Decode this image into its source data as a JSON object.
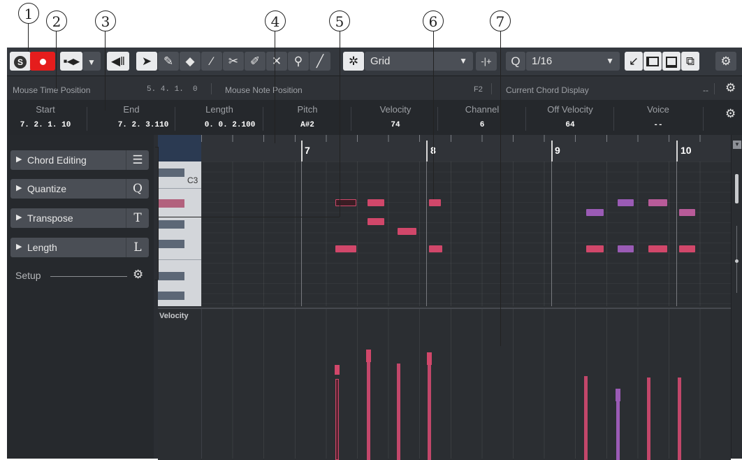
{
  "callouts": [
    "1",
    "2",
    "3",
    "4",
    "5",
    "6",
    "7"
  ],
  "toolbar": {
    "snap_label": "Grid",
    "quantize_label": "1/16",
    "icons": [
      "solo-icon",
      "record-icon",
      "transport-icon",
      "chevron-down-icon",
      "speaker-icon",
      "pointer-icon",
      "pencil-icon",
      "eraser-icon",
      "line-icon",
      "scissors-icon",
      "glue-icon",
      "mute-icon",
      "zoom-icon",
      "draw-icon",
      "snap-icon",
      "chevron-down-icon",
      "snap-toggle-icon",
      "quantize-icon",
      "chevron-down-icon",
      "arrow-icon",
      "left-zone-icon",
      "lower-zone-icon",
      "setup-icon",
      "gear-icon"
    ]
  },
  "infobar": {
    "mouse_time_label": "Mouse Time Position",
    "mouse_time_value": "5. 4. 1.  0",
    "mouse_note_label": "Mouse Note Position",
    "mouse_note_value": "F2",
    "chord_label": "Current Chord Display",
    "chord_value": "--"
  },
  "event": {
    "columns": [
      {
        "label": "Start",
        "value": "7. 2. 1. 10"
      },
      {
        "label": "End",
        "value": "7. 2. 3.110"
      },
      {
        "label": "Length",
        "value": "0. 0. 2.100"
      },
      {
        "label": "Pitch",
        "value": "A#2"
      },
      {
        "label": "Velocity",
        "value": "74"
      },
      {
        "label": "Channel",
        "value": "6"
      },
      {
        "label": "Off Velocity",
        "value": "64"
      },
      {
        "label": "Voice",
        "value": "--"
      }
    ]
  },
  "left": {
    "sections": [
      {
        "label": "Chord Editing",
        "key": "☰"
      },
      {
        "label": "Quantize",
        "key": "Q"
      },
      {
        "label": "Transpose",
        "key": "T"
      },
      {
        "label": "Length",
        "key": "L"
      }
    ],
    "setup_label": "Setup"
  },
  "editor": {
    "bars": [
      "7",
      "8",
      "9",
      "10"
    ],
    "key_label": "C3",
    "velocity_label": "Velocity"
  },
  "colors": {
    "note": "#d1476a",
    "note_alt": "#9a5bb5",
    "record": "#e51d1d"
  }
}
